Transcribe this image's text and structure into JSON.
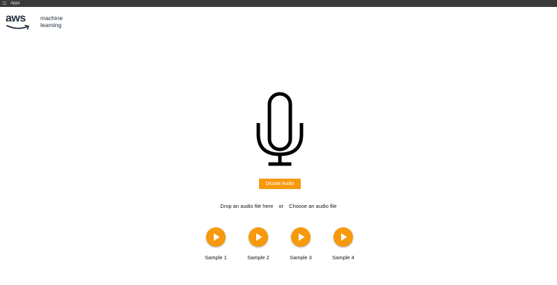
{
  "bookmarks_bar": {
    "apps_label": "Apps"
  },
  "logo": {
    "brand": "aws",
    "line1": "machine",
    "line2": "learning"
  },
  "dictate": {
    "label": "Dictate Audio"
  },
  "upload": {
    "drop_text": "Drop an audio file here",
    "or_text": "or",
    "choose_text": "Choose an audio file"
  },
  "samples": [
    {
      "label": "Sample 1"
    },
    {
      "label": "Sample 2"
    },
    {
      "label": "Sample 3"
    },
    {
      "label": "Sample 4"
    }
  ],
  "colors": {
    "accent": "#f7990c",
    "dark": "#232f3e",
    "topbar": "#3a3a3a"
  },
  "icons": {
    "mic": "microphone-icon",
    "play": "play-icon",
    "apps": "apps-grid-icon",
    "smile": "aws-smile-icon"
  }
}
